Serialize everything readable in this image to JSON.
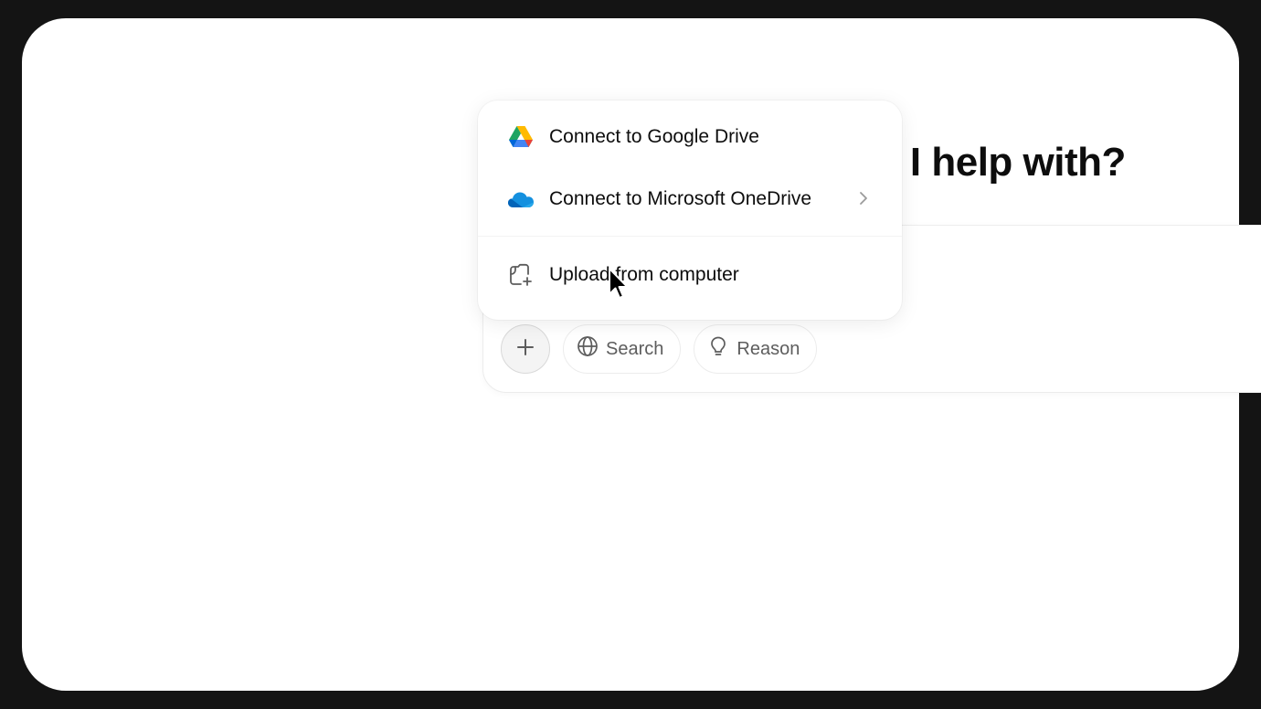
{
  "headline": "at can I help with?",
  "menu": {
    "items": [
      {
        "label": "Connect to Google Drive",
        "icon": "google-drive-icon"
      },
      {
        "label": "Connect to Microsoft OneDrive",
        "icon": "onedrive-icon",
        "has_submenu": true
      },
      {
        "label": "Upload from computer",
        "icon": "upload-file-icon"
      }
    ]
  },
  "toolbar": {
    "plus_icon": "plus-icon",
    "search_label": "Search",
    "search_icon": "globe-icon",
    "reason_label": "Reason",
    "reason_icon": "lightbulb-icon"
  },
  "colors": {
    "frame_bg": "#ffffff",
    "outer_bg": "#141414",
    "text_primary": "#0d0d0d",
    "text_secondary": "#5d5d5d",
    "onedrive_blue": "#0f78d4"
  }
}
